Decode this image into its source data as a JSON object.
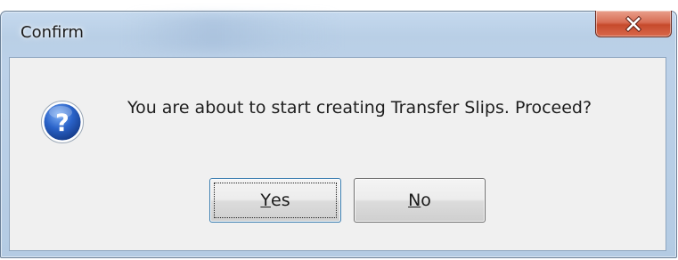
{
  "window": {
    "title": "Confirm",
    "close_icon": "close-x-icon"
  },
  "dialog": {
    "icon": "question-icon",
    "message": "You are about to start creating Transfer Slips. Proceed?"
  },
  "buttons": {
    "yes": {
      "accel": "Y",
      "rest": "es",
      "focused": true
    },
    "no": {
      "accel": "N",
      "rest": "o",
      "focused": false
    }
  },
  "colors": {
    "titlebar": "#bcd1e8",
    "client": "#f0f0f0",
    "close_button": "#c64a2c",
    "question_icon": "#1f55b8"
  }
}
